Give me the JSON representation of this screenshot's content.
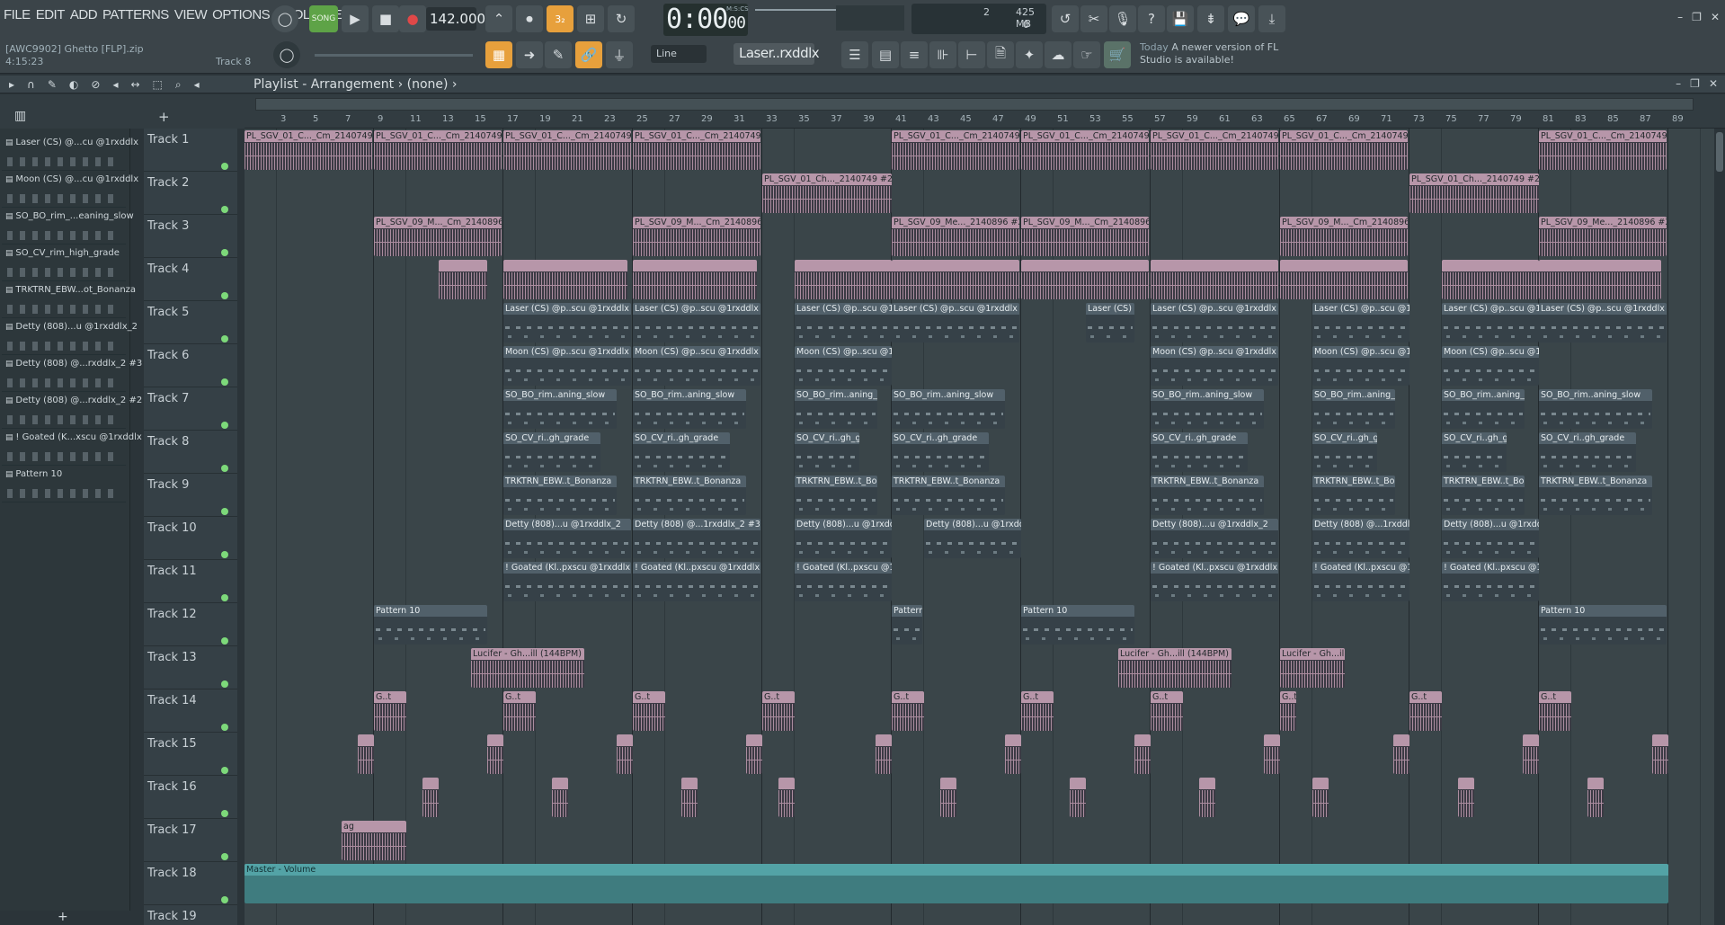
{
  "menu": [
    "FILE",
    "EDIT",
    "ADD",
    "PATTERNS",
    "VIEW",
    "OPTIONS",
    "TOOLS",
    "HELP"
  ],
  "transport": {
    "mode": "SONG",
    "tempo": "142.000",
    "time": "0:00",
    "time_frac": "00",
    "time_unit": "M:S:CS"
  },
  "perf": {
    "cpu": "2",
    "mem": "425 MB",
    "poly": "0"
  },
  "project": {
    "name": "[AWC9902] Ghetto [FLP].zip",
    "time": "4:15:23",
    "hint": "Track 8"
  },
  "pattern_selector": {
    "value": "Laser..rxddlx"
  },
  "snap": {
    "value": "Line"
  },
  "news": {
    "today": "Today",
    "text": "A newer version of FL Studio is available!"
  },
  "playlist": {
    "title": "Playlist - Arrangement",
    "arrangement": "(none)"
  },
  "picker": [
    "Laser (CS) @...cu @1rxddlx",
    "Moon (CS) @...cu @1rxddlx",
    "SO_BO_rim_...eaning_slow",
    "SO_CV_rim_high_grade",
    "TRKTRN_EBW...ot_Bonanza",
    "Detty (808)...u @1rxddlx_2",
    "Detty (808) @...rxddlx_2 #3",
    "Detty (808) @...rxddlx_2 #2",
    "! Goated (K...xscu @1rxddlx",
    "Pattern 10"
  ],
  "ruler": [
    "3",
    "5",
    "7",
    "9",
    "11",
    "13",
    "15",
    "17",
    "19",
    "21",
    "23",
    "25",
    "27",
    "29",
    "31",
    "33",
    "35",
    "37",
    "39",
    "41",
    "43",
    "45",
    "47",
    "49",
    "51",
    "53",
    "55",
    "57",
    "59",
    "61",
    "63",
    "65",
    "67",
    "69",
    "71",
    "73",
    "75",
    "77",
    "79",
    "81",
    "83",
    "85",
    "87",
    "89"
  ],
  "tracks": [
    "Track 1",
    "Track 2",
    "Track 3",
    "Track 4",
    "Track 5",
    "Track 6",
    "Track 7",
    "Track 8",
    "Track 9",
    "Track 10",
    "Track 11",
    "Track 12",
    "Track 13",
    "Track 14",
    "Track 15",
    "Track 16",
    "Track 17",
    "Track 18",
    "Track 19"
  ],
  "clip_names": {
    "t1": "PL_SGV_01_C..._Cm_2140749",
    "t2": "PL_SGV_01_Ch..._2140749 #2",
    "t3": "PL_SGV_09_M..._Cm_2140896",
    "t3b": "PL_SGV_09_Me..._2140896 #2",
    "t5": "Laser (CS) @p..scu @1rxddlx",
    "t6": "Moon (CS) @p..scu @1rxddlx",
    "t7": "SO_BO_rim..aning_slow",
    "t8": "SO_CV_ri..gh_grade",
    "t9": "TRKTRN_EBW..t_Bonanza",
    "t10": "Detty (808)...u @1rxddlx_2",
    "t10b": "Detty (808) @...1rxddlx_2 #3",
    "t11": "! Goated (Kl..pxscu @1rxddlx",
    "t12": "Pattern 10",
    "t13": "Lucifer - Gh...ill (144BPM)",
    "t14": "G..t",
    "t17": "ag",
    "t18": "Master - Volume"
  }
}
